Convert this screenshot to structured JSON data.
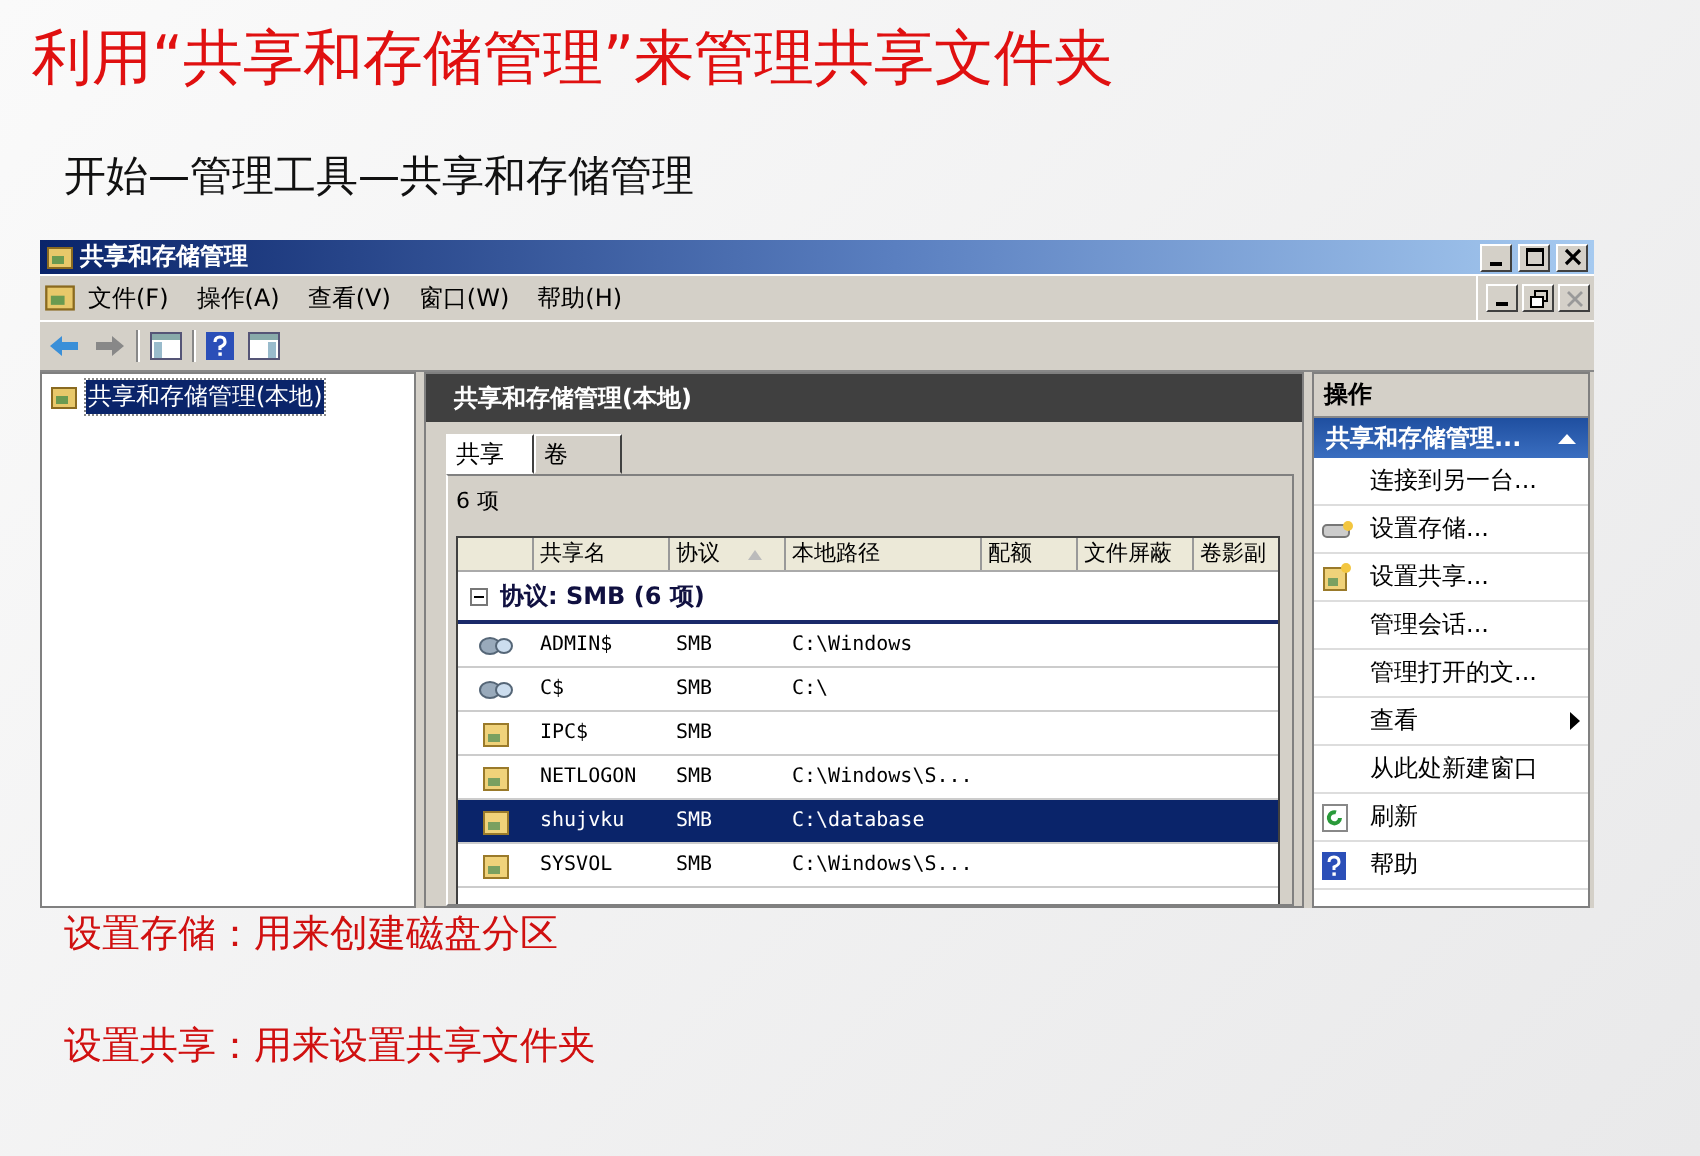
{
  "slide": {
    "title": "利用“共享和存储管理”来管理共享文件夹",
    "subtitle": "开始—管理工具—共享和存储管理",
    "notes": [
      "设置存储：用来创建磁盘分区",
      "设置共享：用来设置共享文件夹"
    ]
  },
  "window": {
    "title": "共享和存储管理"
  },
  "menu": [
    "文件(F)",
    "操作(A)",
    "查看(V)",
    "窗口(W)",
    "帮助(H)"
  ],
  "tree": [
    {
      "label": "共享和存储管理(本地)",
      "selected": true
    }
  ],
  "center": {
    "header": "共享和存储管理(本地)",
    "tabs": [
      {
        "label": "共享",
        "selected": true
      },
      {
        "label": "卷",
        "selected": false
      }
    ],
    "count": "6 项",
    "columns": [
      "共享名",
      "协议",
      "本地路径",
      "配额",
      "文件屏蔽",
      "卷影副"
    ],
    "group": {
      "label": "协议: SMB (6 项)",
      "expanded": true
    },
    "rows": [
      {
        "kind": "admin",
        "name": "ADMIN$",
        "protocol": "SMB",
        "path": "C:\\Windows",
        "selected": false
      },
      {
        "kind": "admin",
        "name": "C$",
        "protocol": "SMB",
        "path": "C:\\",
        "selected": false
      },
      {
        "kind": "folder",
        "name": "IPC$",
        "protocol": "SMB",
        "path": "",
        "selected": false
      },
      {
        "kind": "folder",
        "name": "NETLOGON",
        "protocol": "SMB",
        "path": "C:\\Windows\\S...",
        "selected": false
      },
      {
        "kind": "folder",
        "name": "shujvku",
        "protocol": "SMB",
        "path": "C:\\database",
        "selected": true
      },
      {
        "kind": "folder",
        "name": "SYSVOL",
        "protocol": "SMB",
        "path": "C:\\Windows\\S...",
        "selected": false
      }
    ]
  },
  "actions": {
    "title": "操作",
    "section": "共享和存储管理...",
    "items": [
      {
        "label": "连接到另一台...",
        "kind": "plain"
      },
      {
        "label": "设置存储...",
        "kind": "storage"
      },
      {
        "label": "设置共享...",
        "kind": "share"
      },
      {
        "label": "管理会话...",
        "kind": "plain"
      },
      {
        "label": "管理打开的文...",
        "kind": "plain"
      },
      {
        "label": "查看",
        "kind": "submenu"
      },
      {
        "label": "从此处新建窗口",
        "kind": "plain"
      },
      {
        "label": "刷新",
        "kind": "refresh"
      },
      {
        "label": "帮助",
        "kind": "help"
      }
    ]
  }
}
